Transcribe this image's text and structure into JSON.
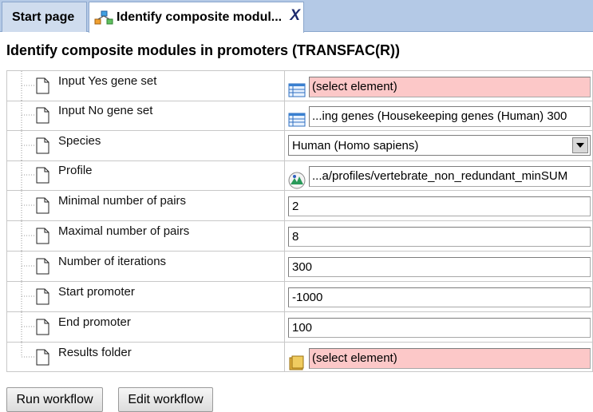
{
  "tabs": [
    {
      "label": "Start page"
    },
    {
      "label": "Identify composite modul...",
      "close": "X"
    }
  ],
  "page_title": "Identify composite modules in promoters (TRANSFAC(R))",
  "params": [
    {
      "label": "Input Yes gene set",
      "type": "element",
      "value": "(select element)",
      "empty": true,
      "icon": "table-icon"
    },
    {
      "label": "Input No gene set",
      "type": "element",
      "value": "...ing genes (Housekeeping genes (Human) 300",
      "empty": false,
      "icon": "table-icon"
    },
    {
      "label": "Species",
      "type": "select",
      "value": "Human (Homo sapiens)"
    },
    {
      "label": "Profile",
      "type": "element",
      "value": "...a/profiles/vertebrate_non_redundant_minSUM",
      "empty": false,
      "icon": "profile-icon"
    },
    {
      "label": "Minimal number of pairs",
      "type": "text",
      "value": "2"
    },
    {
      "label": "Maximal number of pairs",
      "type": "text",
      "value": "8"
    },
    {
      "label": "Number of iterations",
      "type": "text",
      "value": "300"
    },
    {
      "label": "Start promoter",
      "type": "text",
      "value": "-1000"
    },
    {
      "label": "End promoter",
      "type": "text",
      "value": "100"
    },
    {
      "label": "Results folder",
      "type": "element",
      "value": "(select element)",
      "empty": true,
      "icon": "folder-icon"
    }
  ],
  "buttons": {
    "run": "Run workflow",
    "edit": "Edit workflow"
  },
  "colors": {
    "tabbar": "#b4c9e6",
    "empty_field": "#fcc8c8",
    "border": "#c8c8c8"
  }
}
